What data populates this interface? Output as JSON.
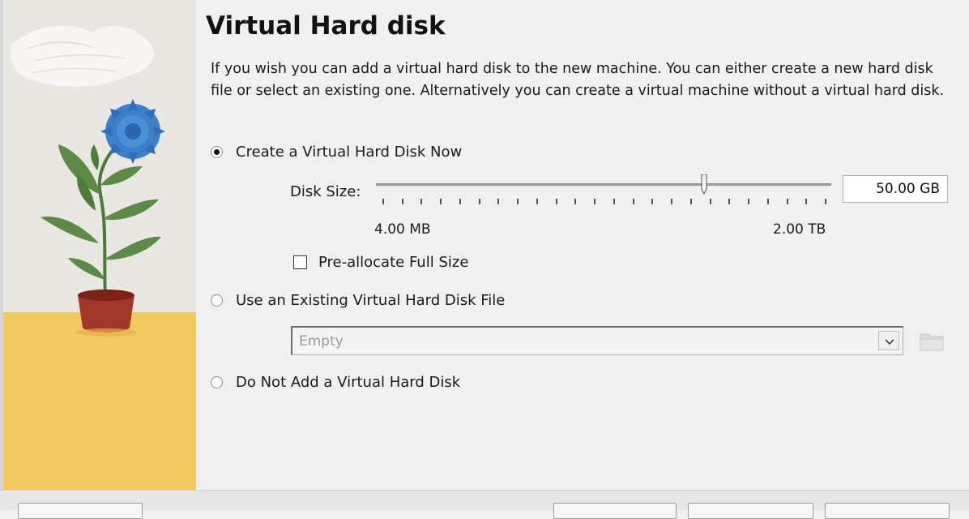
{
  "header": {
    "title": "Virtual Hard disk"
  },
  "description": "If you wish you can add a virtual hard disk to the new machine. You can either create a new hard disk file or select an existing one. Alternatively you can create a virtual machine without a virtual hard disk.",
  "options": {
    "create_now": {
      "label": "Create a Virtual Hard Disk Now",
      "selected": true
    },
    "use_existing": {
      "label": "Use an Existing Virtual Hard Disk File",
      "selected": false
    },
    "do_not_add": {
      "label": "Do Not Add a Virtual Hard Disk",
      "selected": false
    }
  },
  "disk_size": {
    "label": "Disk Size:",
    "value": "50.00 GB",
    "min_label": "4.00 MB",
    "max_label": "2.00 TB",
    "slider_position_fraction": 0.72,
    "tick_count": 24
  },
  "preallocate": {
    "label": "Pre-allocate Full Size",
    "checked": false
  },
  "existing_file": {
    "value": "Empty"
  },
  "icons": {
    "illustration": "flower-pot-illustration",
    "combo_arrow": "chevron-down-icon",
    "folder": "folder-open-icon"
  }
}
